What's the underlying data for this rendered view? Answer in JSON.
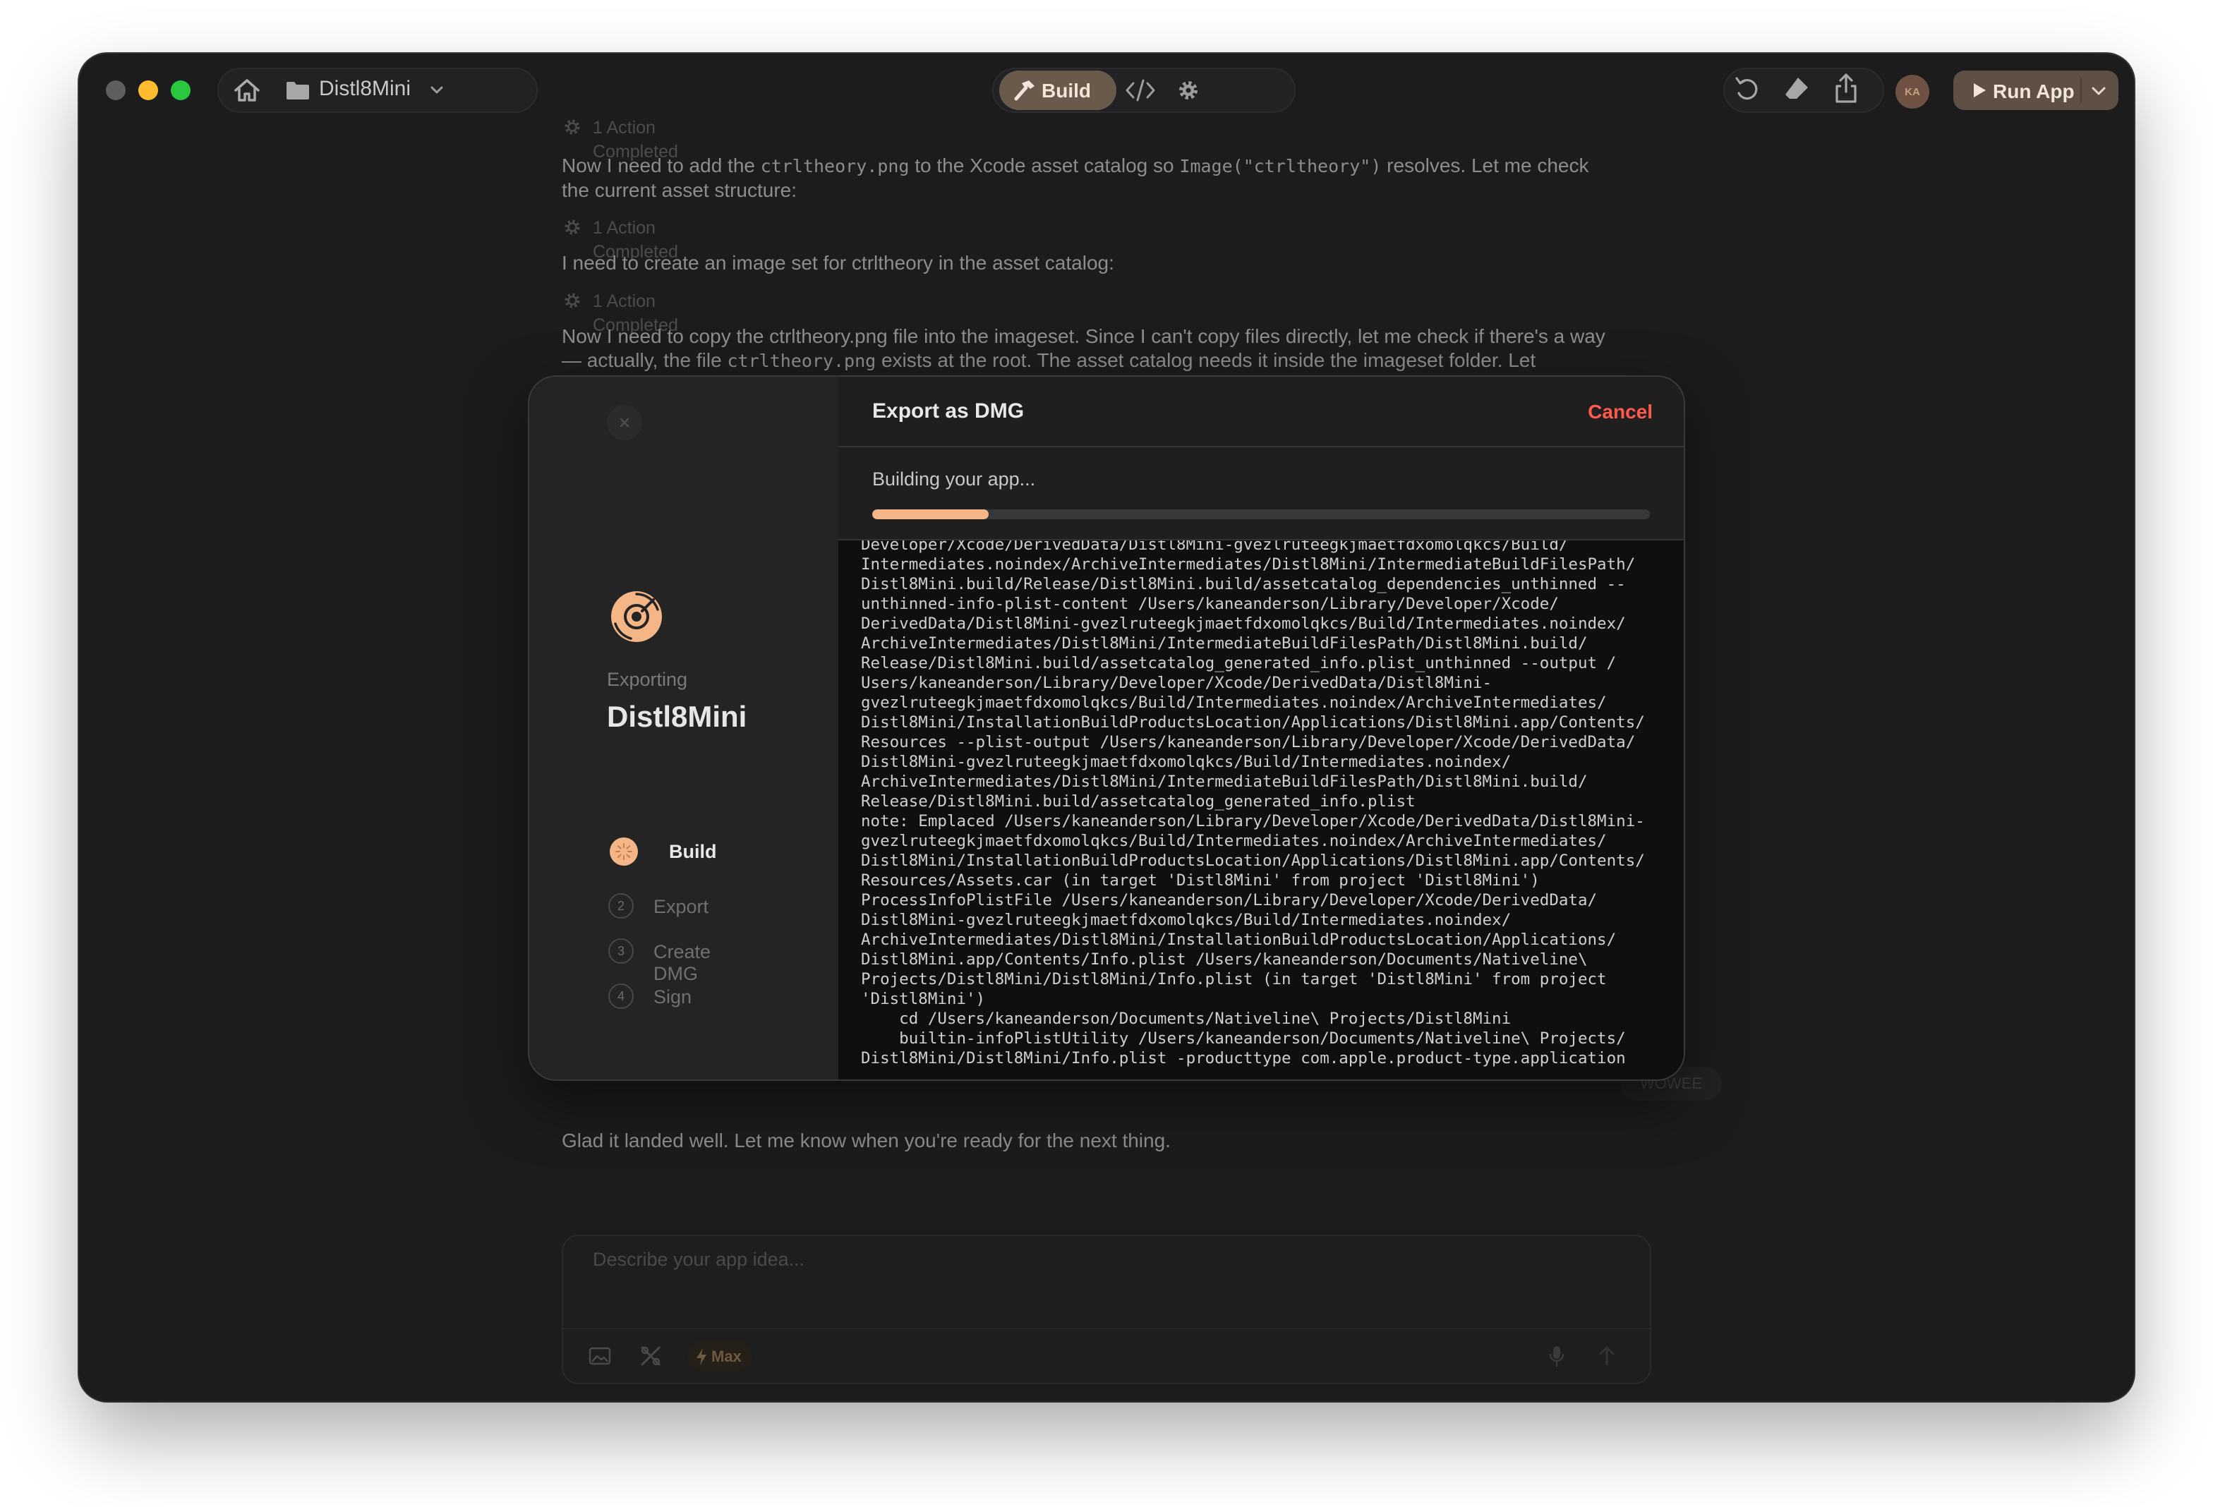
{
  "titlebar": {
    "project_name": "Distl8Mini",
    "build_label": "Build",
    "avatar_initials": "KA",
    "run_label": "Run App"
  },
  "chat": {
    "action_completed": "1 Action Completed",
    "msg1_a": "Now I need to add the ",
    "msg1_code1": "ctrltheory.png",
    "msg1_b": " to the Xcode asset catalog so ",
    "msg1_code2": "Image(\"ctrltheory\")",
    "msg1_c": " resolves. Let me check the current asset structure:",
    "msg2": "I need to create an image set for ctrltheory in the asset catalog:",
    "msg3_a": "Now I need to copy the ctrltheory.png file into the imageset. Since I can't copy files directly, let me check if there's a way — actually, the file ",
    "msg3_code": "ctrltheory.png",
    "msg3_b": " exists at the root. The asset catalog needs it inside the imageset folder. Let",
    "hidden_chip": "WOWEE",
    "final_message": "Glad it landed well. Let me know when you're ready for the next thing."
  },
  "composer": {
    "placeholder": "Describe your app idea...",
    "mode_label": "Max"
  },
  "modal": {
    "exporting_label": "Exporting",
    "project_name": "Distl8Mini",
    "title": "Export as DMG",
    "cancel_label": "Cancel",
    "status": "Building your app...",
    "progress": 0.15,
    "steps": [
      {
        "num": "1",
        "label": "Build"
      },
      {
        "num": "2",
        "label": "Export"
      },
      {
        "num": "3",
        "label": "Create DMG"
      },
      {
        "num": "4",
        "label": "Sign"
      }
    ],
    "log": "Developer/Xcode/DerivedData/Distl8Mini-gvezlruteegkjmaetfdxomolqkcs/Build/\nIntermediates.noindex/ArchiveIntermediates/Distl8Mini/IntermediateBuildFilesPath/\nDistl8Mini.build/Release/Distl8Mini.build/assetcatalog_dependencies_unthinned --\nunthinned-info-plist-content /Users/kaneanderson/Library/Developer/Xcode/\nDerivedData/Distl8Mini-gvezlruteegkjmaetfdxomolqkcs/Build/Intermediates.noindex/\nArchiveIntermediates/Distl8Mini/IntermediateBuildFilesPath/Distl8Mini.build/\nRelease/Distl8Mini.build/assetcatalog_generated_info.plist_unthinned --output /\nUsers/kaneanderson/Library/Developer/Xcode/DerivedData/Distl8Mini-\ngvezlruteegkjmaetfdxomolqkcs/Build/Intermediates.noindex/ArchiveIntermediates/\nDistl8Mini/InstallationBuildProductsLocation/Applications/Distl8Mini.app/Contents/\nResources --plist-output /Users/kaneanderson/Library/Developer/Xcode/DerivedData/\nDistl8Mini-gvezlruteegkjmaetfdxomolqkcs/Build/Intermediates.noindex/\nArchiveIntermediates/Distl8Mini/IntermediateBuildFilesPath/Distl8Mini.build/\nRelease/Distl8Mini.build/assetcatalog_generated_info.plist\nnote: Emplaced /Users/kaneanderson/Library/Developer/Xcode/DerivedData/Distl8Mini-\ngvezlruteegkjmaetfdxomolqkcs/Build/Intermediates.noindex/ArchiveIntermediates/\nDistl8Mini/InstallationBuildProductsLocation/Applications/Distl8Mini.app/Contents/\nResources/Assets.car (in target 'Distl8Mini' from project 'Distl8Mini')\nProcessInfoPlistFile /Users/kaneanderson/Library/Developer/Xcode/DerivedData/\nDistl8Mini-gvezlruteegkjmaetfdxomolqkcs/Build/Intermediates.noindex/\nArchiveIntermediates/Distl8Mini/InstallationBuildProductsLocation/Applications/\nDistl8Mini.app/Contents/Info.plist /Users/kaneanderson/Documents/Nativeline\\\nProjects/Distl8Mini/Distl8Mini/Info.plist (in target 'Distl8Mini' from project\n'Distl8Mini')\n    cd /Users/kaneanderson/Documents/Nativeline\\ Projects/Distl8Mini\n    builtin-infoPlistUtility /Users/kaneanderson/Documents/Nativeline\\ Projects/\nDistl8Mini/Distl8Mini/Info.plist -producttype com.apple.product-type.application"
  }
}
